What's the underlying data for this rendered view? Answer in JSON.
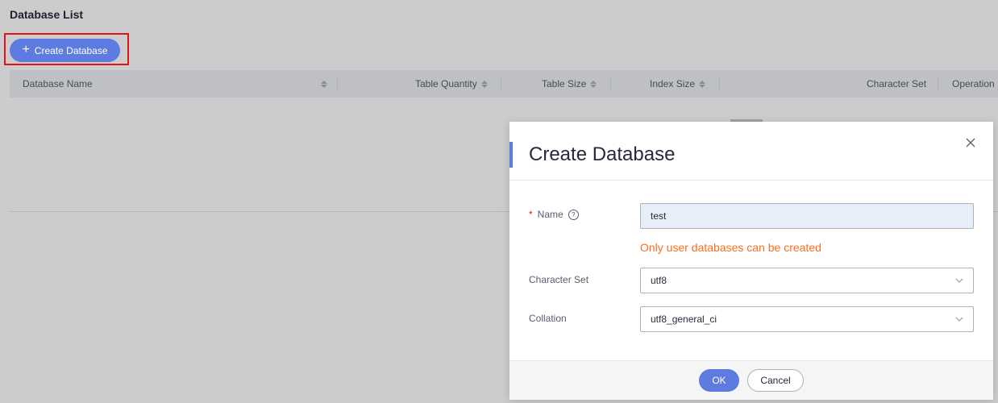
{
  "page": {
    "title": "Database List",
    "create_button_label": "Create Database",
    "columns": [
      {
        "label": "Database Name",
        "sortable": true
      },
      {
        "label": "Table Quantity",
        "sortable": true
      },
      {
        "label": "Table Size",
        "sortable": true
      },
      {
        "label": "Index Size",
        "sortable": true
      },
      {
        "label": "Character Set",
        "sortable": false
      },
      {
        "label": "Operation",
        "sortable": false
      }
    ]
  },
  "dialog": {
    "title": "Create Database",
    "name_label": "Name",
    "name_value": "test",
    "name_hint": "Only user databases can be created",
    "charset_label": "Character Set",
    "charset_value": "utf8",
    "collation_label": "Collation",
    "collation_value": "utf8_general_ci",
    "ok_label": "OK",
    "cancel_label": "Cancel"
  },
  "colors": {
    "primary": "#5e7ce0",
    "highlight_border": "#e0121b",
    "hint": "#f66f1f",
    "required": "#e0121b"
  },
  "icons": {
    "create": "plus-icon",
    "sort": "sort-icon",
    "close": "close-icon",
    "help": "help-icon",
    "dropdown": "chevron-down-icon"
  }
}
